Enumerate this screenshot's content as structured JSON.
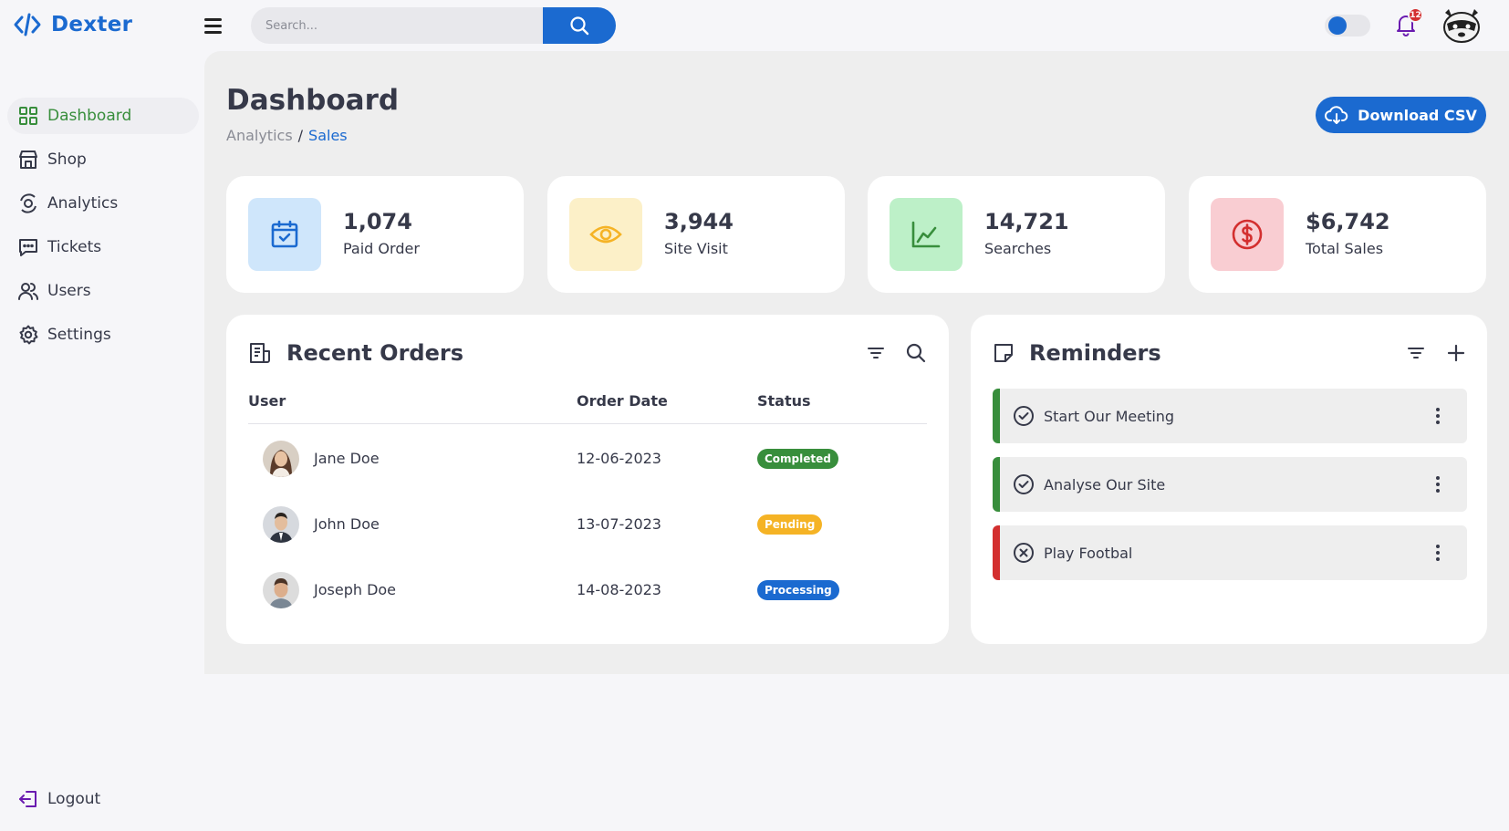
{
  "app": {
    "name": "Dexter",
    "notification_count": "12"
  },
  "search": {
    "placeholder": "Search..."
  },
  "sidebar": {
    "items": [
      {
        "label": "Dashboard"
      },
      {
        "label": "Shop"
      },
      {
        "label": "Analytics"
      },
      {
        "label": "Tickets"
      },
      {
        "label": "Users"
      },
      {
        "label": "Settings"
      }
    ],
    "logout_label": "Logout"
  },
  "page": {
    "title": "Dashboard",
    "breadcrumb": [
      "Analytics",
      "/",
      "Sales"
    ],
    "download_label": "Download CSV"
  },
  "stats": [
    {
      "value": "1,074",
      "label": "Paid Order",
      "icon": "calendar-check-icon",
      "color": "#1b6ad0"
    },
    {
      "value": "3,944",
      "label": "Site Visit",
      "icon": "eye-icon",
      "color": "#f5b325"
    },
    {
      "value": "14,721",
      "label": "Searches",
      "icon": "line-chart-icon",
      "color": "#388e3c"
    },
    {
      "value": "$6,742",
      "label": "Total Sales",
      "icon": "dollar-circle-icon",
      "color": "#d32f2f"
    }
  ],
  "orders": {
    "title": "Recent Orders",
    "columns": [
      "User",
      "Order Date",
      "Status"
    ],
    "rows": [
      {
        "name": "Jane Doe",
        "date": "12-06-2023",
        "status": "Completed",
        "status_color": "#388e3c"
      },
      {
        "name": "John Doe",
        "date": "13-07-2023",
        "status": "Pending",
        "status_color": "#f5b325"
      },
      {
        "name": "Joseph Doe",
        "date": "14-08-2023",
        "status": "Processing",
        "status_color": "#1b6ad0"
      }
    ]
  },
  "reminders": {
    "title": "Reminders",
    "items": [
      {
        "label": "Start Our Meeting",
        "state": "done",
        "color": "#388e3c"
      },
      {
        "label": "Analyse Our Site",
        "state": "done",
        "color": "#388e3c"
      },
      {
        "label": "Play Footbal",
        "state": "cancelled",
        "color": "#d32f2f"
      }
    ]
  },
  "colors": {
    "primary": "#1b6ad0",
    "success": "#388e3c",
    "warning": "#f5b325",
    "danger": "#d32f2f"
  }
}
